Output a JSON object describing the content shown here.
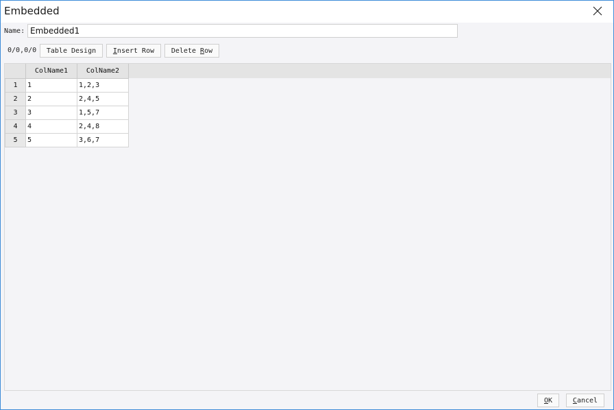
{
  "window": {
    "title": "Embedded",
    "close_icon": "close-icon"
  },
  "name_row": {
    "label": "Name:",
    "value": "Embedded1"
  },
  "toolbar": {
    "position": "0/0,0/0",
    "table_design": {
      "before": "",
      "underline": "",
      "after": "Table Design"
    },
    "insert_row": {
      "before": "",
      "underline": "I",
      "after": "nsert Row"
    },
    "delete_row": {
      "before": "Delete ",
      "underline": "R",
      "after": "ow"
    }
  },
  "grid": {
    "columns": [
      "ColName1",
      "ColName2"
    ],
    "rows": [
      {
        "num": "1",
        "cells": [
          "1",
          "1,2,3"
        ]
      },
      {
        "num": "2",
        "cells": [
          "2",
          "2,4,5"
        ]
      },
      {
        "num": "3",
        "cells": [
          "3",
          "1,5,7"
        ]
      },
      {
        "num": "4",
        "cells": [
          "4",
          "2,4,8"
        ]
      },
      {
        "num": "5",
        "cells": [
          "5",
          "3,6,7"
        ]
      }
    ]
  },
  "footer": {
    "ok": {
      "underline": "O",
      "after": "K"
    },
    "cancel": {
      "underline": "C",
      "after": "ancel"
    }
  },
  "colors": {
    "window_border": "#3c8bd8",
    "background": "#f4f4f7",
    "header_band": "#e4e4e4"
  }
}
